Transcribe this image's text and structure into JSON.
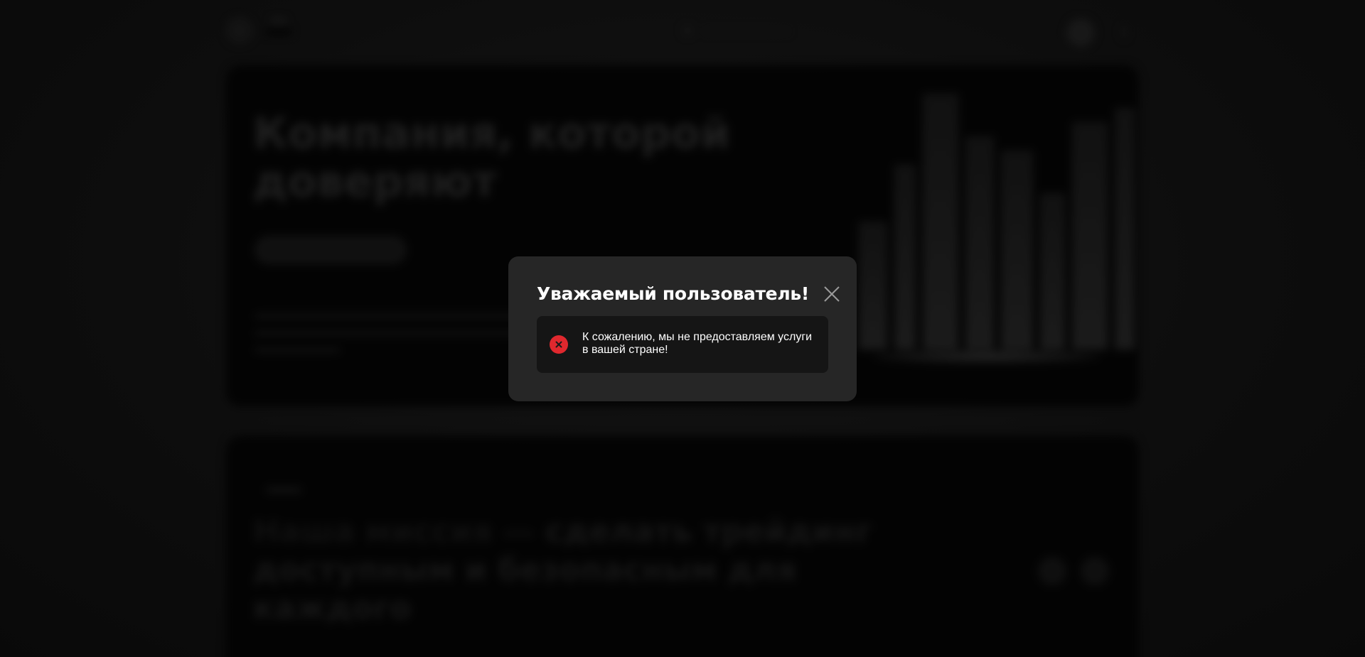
{
  "modal": {
    "title": "Уважаемый пользователь!",
    "message": "К сожалению, мы не предоставляем услуги в вашей стране!",
    "close_icon": "close-icon",
    "alert_icon": "error-circle-icon",
    "alert_color": "#e0282e"
  },
  "background": {
    "hero_title": "Компания, которой доверяют",
    "mission_title_part1": "Наша миссия — ",
    "mission_title_part2": "сделать трейдинг доступным и безопасным для каждого"
  },
  "colors": {
    "modal_bg": "#262626",
    "alert_bg": "#151515",
    "text": "#ffffff"
  }
}
